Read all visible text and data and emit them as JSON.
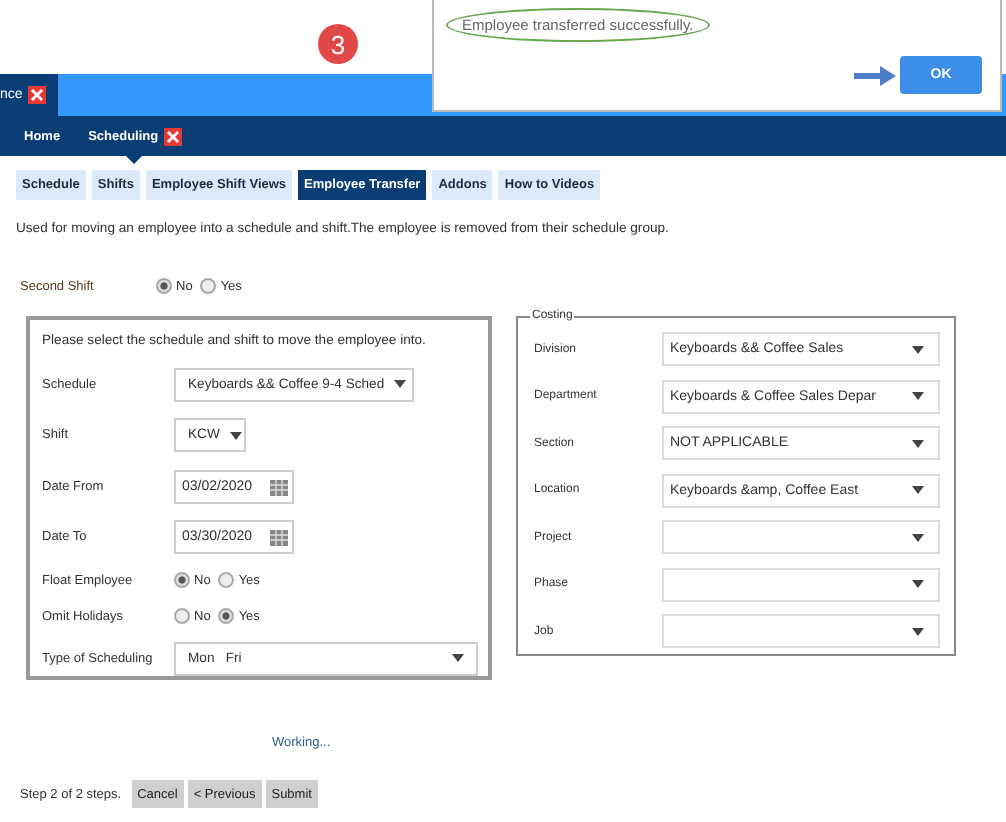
{
  "dialog": {
    "message": "Employee transferred successfully.",
    "ok_button": "OK"
  },
  "step_marker": "3",
  "window_tabs": [
    {
      "label": "nce",
      "selected": true
    }
  ],
  "nav": [
    {
      "label": "Home",
      "closable": false,
      "selected": false
    },
    {
      "label": "Scheduling",
      "closable": true,
      "selected": true
    }
  ],
  "subtabs": [
    {
      "label": "Schedule",
      "selected": false
    },
    {
      "label": "Shifts",
      "selected": false
    },
    {
      "label": "Employee Shift Views",
      "selected": false
    },
    {
      "label": "Employee Transfer",
      "selected": true
    },
    {
      "label": "Addons",
      "selected": false
    },
    {
      "label": "How to Videos",
      "selected": false
    }
  ],
  "description": "Used for moving an employee into a schedule and shift.The employee is removed from their schedule group.",
  "second_shift": {
    "label": "Second Shift",
    "options": [
      {
        "label": "No",
        "selected": true
      },
      {
        "label": "Yes",
        "selected": false
      }
    ]
  },
  "schedule_panel": {
    "instruction": "Please select the schedule and shift to move the employee into.",
    "fields": [
      {
        "kind": "select",
        "label": "Schedule",
        "value": "Keyboards && Coffee 9-4 Sched"
      },
      {
        "kind": "select",
        "label": "Shift",
        "value": "KCW"
      },
      {
        "kind": "date",
        "label": "Date From",
        "value": "03/02/2020"
      },
      {
        "kind": "date",
        "label": "Date To",
        "value": "03/30/2020"
      },
      {
        "kind": "radio",
        "label": "Float Employee",
        "options": [
          {
            "label": "No",
            "selected": true
          },
          {
            "label": "Yes",
            "selected": false
          }
        ]
      },
      {
        "kind": "radio",
        "label": "Omit Holidays",
        "options": [
          {
            "label": "No",
            "selected": false
          },
          {
            "label": "Yes",
            "selected": true
          }
        ]
      },
      {
        "kind": "select",
        "label": "Type of Scheduling",
        "value": "Mon   Fri"
      }
    ]
  },
  "costing": {
    "title": "Costing",
    "fields": [
      {
        "label": "Division",
        "value": "Keyboards && Coffee Sales"
      },
      {
        "label": "Department",
        "value": "Keyboards & Coffee Sales Depar"
      },
      {
        "label": "Section",
        "value": "NOT APPLICABLE"
      },
      {
        "label": "Location",
        "value": "Keyboards &amp, Coffee East"
      },
      {
        "label": "Project"
      },
      {
        "label": "Phase"
      },
      {
        "label": "Job"
      }
    ]
  },
  "status": "Working...",
  "footer": {
    "step_text": "Step 2 of 2 steps.",
    "buttons": [
      "Cancel",
      "< Previous",
      "Submit"
    ]
  }
}
